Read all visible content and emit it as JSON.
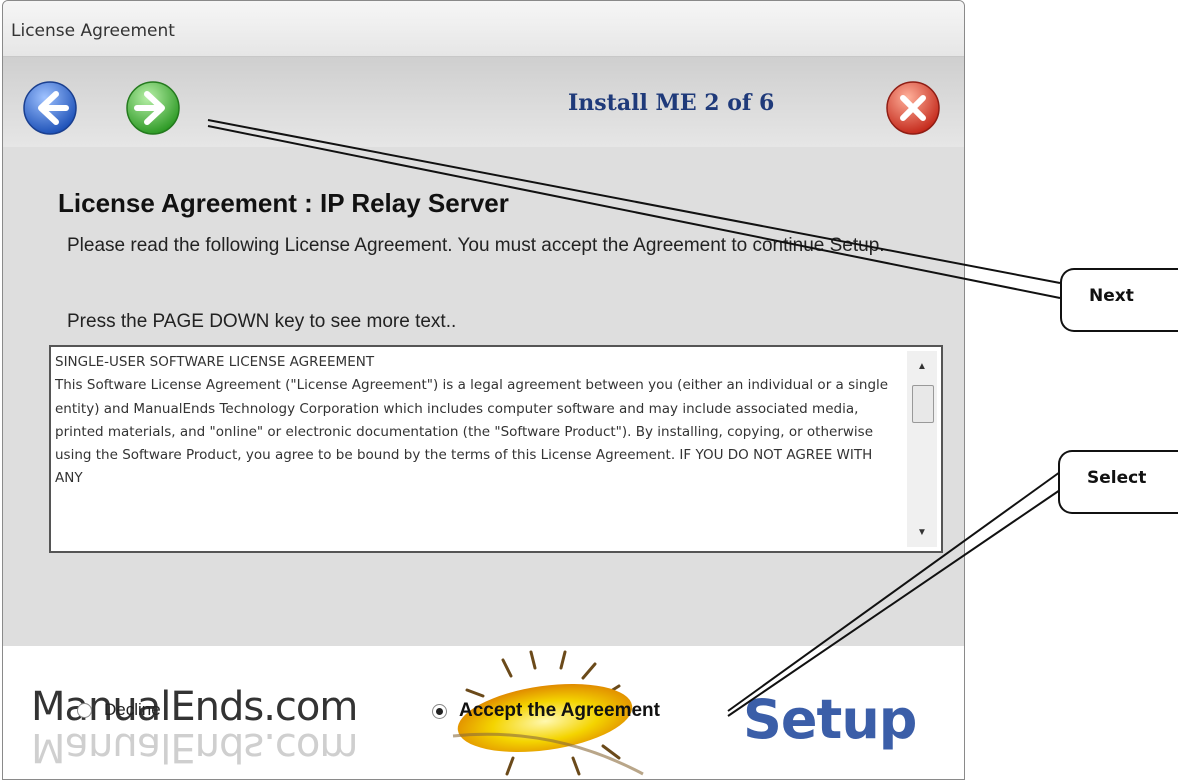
{
  "window": {
    "title": "License Agreement",
    "step": "Install ME 2 of 6"
  },
  "toolbar": {
    "back_icon": "back-arrow-icon",
    "next_icon": "next-arrow-icon",
    "close_icon": "close-icon",
    "colors": {
      "back": "#3a6fd0",
      "next": "#3fae3a",
      "close": "#d8382c"
    }
  },
  "content": {
    "heading": "License Agreement :  IP Relay Server",
    "instruction": "Please read the following License Agreement.  You must accept the Agreement to continue Setup.",
    "press_text": "Press the PAGE DOWN key to see more text..",
    "license_text": "SINGLE-USER SOFTWARE LICENSE AGREEMENT\nThis Software License Agreement (\"License Agreement\") is a legal agreement between you (either an individual or a single entity) and ManualEnds Technology Corporation which includes computer software and may include associated media, printed materials, and \"online\" or electronic documentation (the \"Software Product\"). By installing, copying, or otherwise using the Software Product, you agree to be bound by the terms of this License Agreement. IF YOU DO NOT AGREE WITH ANY"
  },
  "options": {
    "decline_label": "Decline",
    "accept_label": "Accept the Agreement",
    "selected": "accept"
  },
  "banner": {
    "brand": "ManualEnds.com",
    "setup_word": "Setup"
  },
  "callouts": {
    "next_label": "Next",
    "select_label": "Select"
  }
}
